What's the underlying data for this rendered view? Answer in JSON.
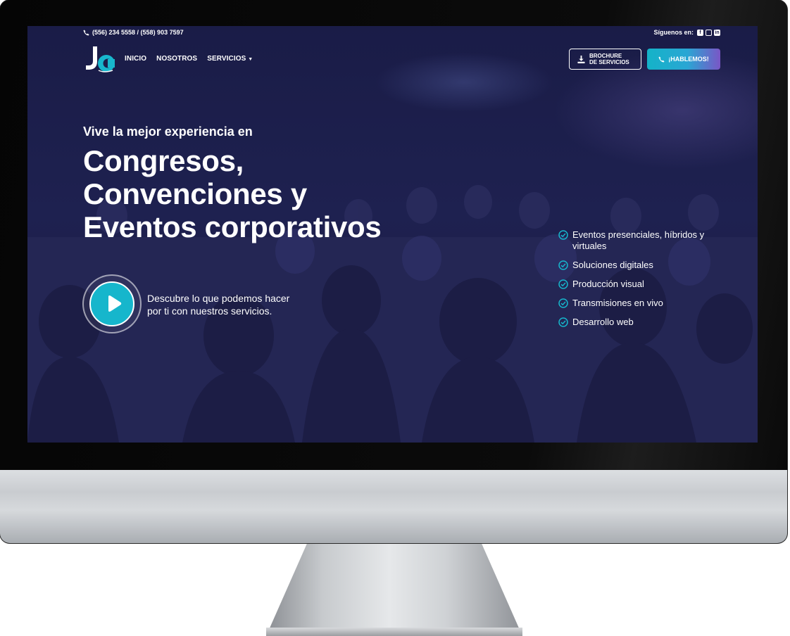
{
  "topbar": {
    "phone": "(556) 234 5558 / (558) 903 7597",
    "follow_label": "Síguenos en:",
    "social_icons": [
      "facebook-icon",
      "instagram-icon",
      "linkedin-icon"
    ]
  },
  "nav": {
    "logo_icon": "jc-logo",
    "menu": [
      "INICIO",
      "NOSOTROS",
      "SERVICIOS"
    ],
    "brochure_line1": "BROCHURE",
    "brochure_line2": "DE SERVICIOS",
    "cta_label": "¡HABLEMOS!"
  },
  "hero": {
    "subtitle": "Vive la mejor experiencia en",
    "headline": [
      "Congresos,",
      "Convenciones y",
      "Eventos corporativos"
    ],
    "video_line1": "Descubre lo que podemos hacer",
    "video_line2": "por ti con nuestros servicios."
  },
  "features": [
    "Eventos presenciales, híbridos y virtuales",
    "Soluciones digitales",
    "Producción visual",
    "Transmisiones en vivo",
    "Desarrollo web"
  ],
  "colors": {
    "accent": "#16b6cc",
    "background": "#1d1f4c",
    "cta_gradient_end": "#7a56c6"
  }
}
